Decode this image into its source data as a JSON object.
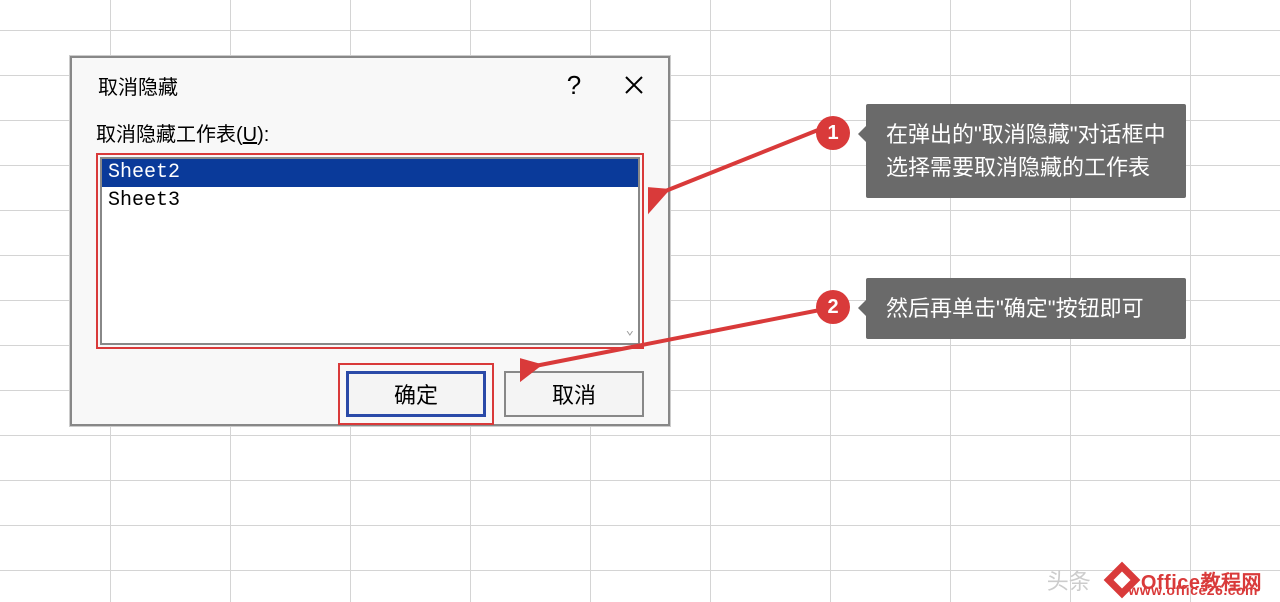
{
  "dialog": {
    "title": "取消隐藏",
    "help_symbol": "?",
    "list_label_prefix": "取消隐藏工作表(",
    "list_label_accelerator": "U",
    "list_label_suffix": "):",
    "items": [
      {
        "label": "Sheet2",
        "selected": true
      },
      {
        "label": "Sheet3",
        "selected": false
      }
    ],
    "ok_label": "确定",
    "cancel_label": "取消"
  },
  "callouts": {
    "step1_num": "1",
    "step1_text": "在弹出的\"取消隐藏\"对话框中选择需要取消隐藏的工作表",
    "step2_num": "2",
    "step2_text": "然后再单击\"确定\"按钮即可"
  },
  "watermark": {
    "faded": "头条",
    "brand": "Office教程网",
    "url": "www.office26.com"
  }
}
